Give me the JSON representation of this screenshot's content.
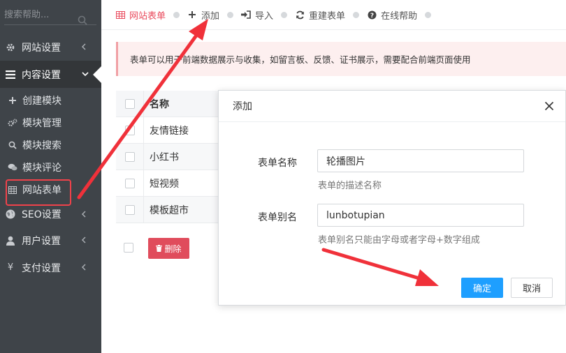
{
  "sidebar": {
    "search_placeholder": "搜索帮助...",
    "items": [
      {
        "label": "网站设置",
        "icon": "gear-icon"
      },
      {
        "label": "内容设置",
        "icon": "menu-icon"
      },
      {
        "label": "SEO设置",
        "icon": "globe-icon"
      },
      {
        "label": "用户设置",
        "icon": "user-icon"
      },
      {
        "label": "支付设置",
        "icon": "yen-icon"
      }
    ],
    "sub_items": [
      {
        "label": "创建模块",
        "icon": "plus-icon"
      },
      {
        "label": "模块管理",
        "icon": "cogs-icon"
      },
      {
        "label": "模块搜索",
        "icon": "search-icon"
      },
      {
        "label": "模块评论",
        "icon": "comments-icon"
      },
      {
        "label": "网站表单",
        "icon": "table-icon"
      }
    ]
  },
  "topbar": {
    "items": [
      {
        "label": "网站表单",
        "icon": "table-icon"
      },
      {
        "label": "添加",
        "icon": "plus-icon"
      },
      {
        "label": "导入",
        "icon": "import-icon"
      },
      {
        "label": "重建表单",
        "icon": "refresh-icon"
      },
      {
        "label": "在线帮助",
        "icon": "help-icon"
      }
    ]
  },
  "notice": {
    "text": "表单可以用于前端数据展示与收集，如留言板、反馈、证书展示，需要配合前端页面使用"
  },
  "table": {
    "header": "名称",
    "rows": [
      "友情链接",
      "小红书",
      "短视频",
      "模板超市"
    ]
  },
  "bulk": {
    "delete_label": "删除"
  },
  "modal": {
    "title": "添加",
    "fields": [
      {
        "label": "表单名称",
        "value": "轮播图片",
        "hint": "表单的描述名称"
      },
      {
        "label": "表单别名",
        "value": "lunbotupian",
        "hint": "表单别名只能由字母或者字母+数字组成"
      }
    ],
    "confirm_label": "确定",
    "cancel_label": "取消"
  },
  "colors": {
    "sidebar_bg": "#3f4449",
    "accent_red": "#e94a5c",
    "primary_blue": "#1e9fff",
    "annotation_red": "#f0313a"
  }
}
